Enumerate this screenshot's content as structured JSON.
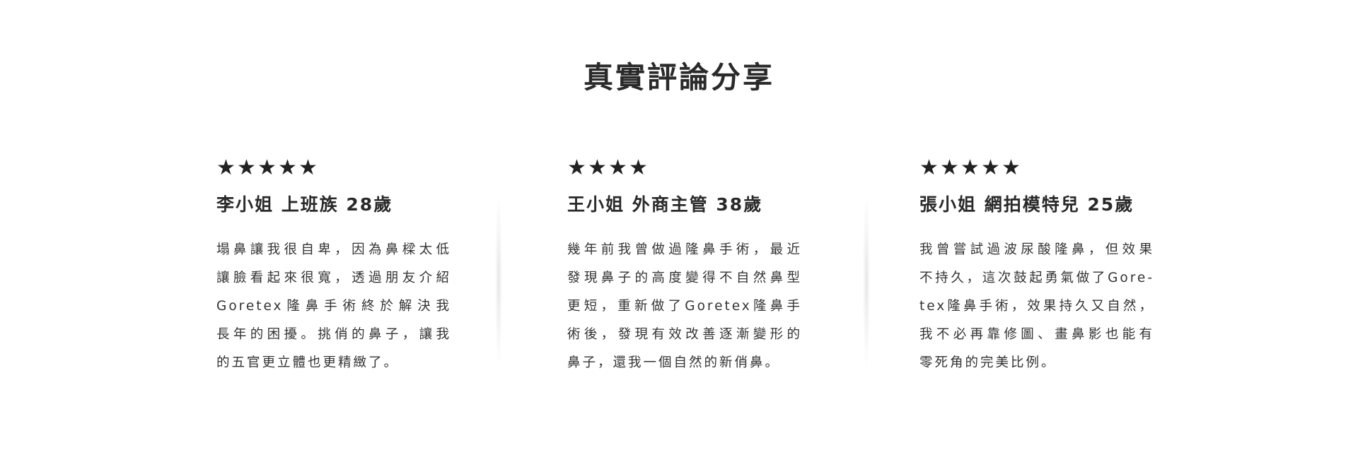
{
  "section": {
    "title": "真實評論分享"
  },
  "colors": {
    "text": "#2b2b2b",
    "stars": "#222222",
    "background": "#ffffff"
  },
  "reviews": [
    {
      "rating": 5,
      "star_glyph": "★",
      "reviewer": "李小姐 上班族 28歲",
      "lines": [
        "塌鼻讓我很自卑，因為鼻樑太低",
        "讓臉看起來很寬，透過朋友介紹",
        "Goretex隆鼻手術終於解決我",
        "長年的困擾。挑俏的鼻子，讓我",
        "的五官更立體也更精緻了。"
      ]
    },
    {
      "rating": 4,
      "star_glyph": "★",
      "reviewer": "王小姐 外商主管 38歲",
      "lines": [
        "幾年前我曾做過隆鼻手術，最近",
        "發現鼻子的高度變得不自然鼻型",
        "更短，重新做了Goretex隆鼻手",
        "術後，發現有效改善逐漸變形的",
        "鼻子，還我一個自然的新俏鼻。"
      ]
    },
    {
      "rating": 5,
      "star_glyph": "★",
      "reviewer": "張小姐 網拍模特兒 25歲",
      "lines": [
        "我曾嘗試過波尿酸隆鼻，但效果",
        "不持久，這次鼓起勇氣做了Gore-",
        "tex隆鼻手術，效果持久又自然，",
        "我不必再靠修圖、畫鼻影也能有",
        "零死角的完美比例。"
      ]
    }
  ]
}
